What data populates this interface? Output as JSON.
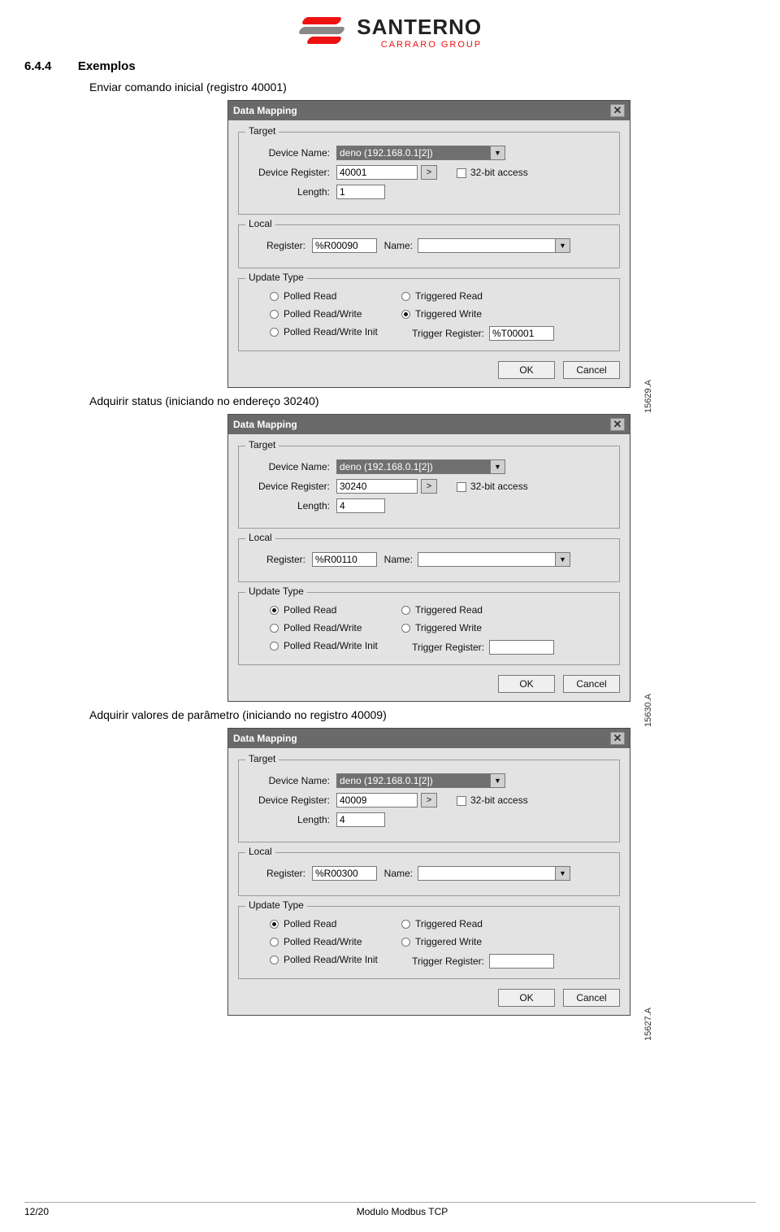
{
  "logo": {
    "brand": "SANTERNO",
    "sub": "CARRARO GROUP"
  },
  "section": {
    "number": "6.4.4",
    "title": "Exemplos"
  },
  "captions": {
    "c1": "Enviar comando inicial (registro 40001)",
    "c2": "Adquirir status (iniciando no endereço 30240)",
    "c3": "Adquirir valores de parâmetro (iniciando no registro 40009)"
  },
  "dialog_common": {
    "title": "Data Mapping",
    "group_target": "Target",
    "group_local": "Local",
    "group_update": "Update Type",
    "lbl_device_name": "Device Name:",
    "lbl_device_register": "Device Register:",
    "lbl_length": "Length:",
    "lbl_32bit": "32-bit access",
    "lbl_register": "Register:",
    "lbl_name": "Name:",
    "radio_polled_read": "Polled Read",
    "radio_polled_rw": "Polled Read/Write",
    "radio_polled_rw_init": "Polled Read/Write Init",
    "radio_trig_read": "Triggered Read",
    "radio_trig_write": "Triggered Write",
    "lbl_trigger_register": "Trigger Register:",
    "btn_ok": "OK",
    "btn_cancel": "Cancel",
    "gt": ">"
  },
  "dlg1": {
    "device_name": "deno (192.168.0.1[2])",
    "device_register": "40001",
    "length": "1",
    "local_register": "%R00090",
    "local_name": "",
    "selected_radio": "trig_write",
    "trigger_register": "%T00001",
    "side": "15629.A"
  },
  "dlg2": {
    "device_name": "deno (192.168.0.1[2])",
    "device_register": "30240",
    "length": "4",
    "local_register": "%R00110",
    "local_name": "",
    "selected_radio": "polled_read",
    "trigger_register": "",
    "side": "15630.A"
  },
  "dlg3": {
    "device_name": "deno (192.168.0.1[2])",
    "device_register": "40009",
    "length": "4",
    "local_register": "%R00300",
    "local_name": "",
    "selected_radio": "polled_read",
    "trigger_register": "",
    "side": "15627.A"
  },
  "footer": {
    "page": "12/20",
    "title": "Modulo Modbus TCP"
  }
}
